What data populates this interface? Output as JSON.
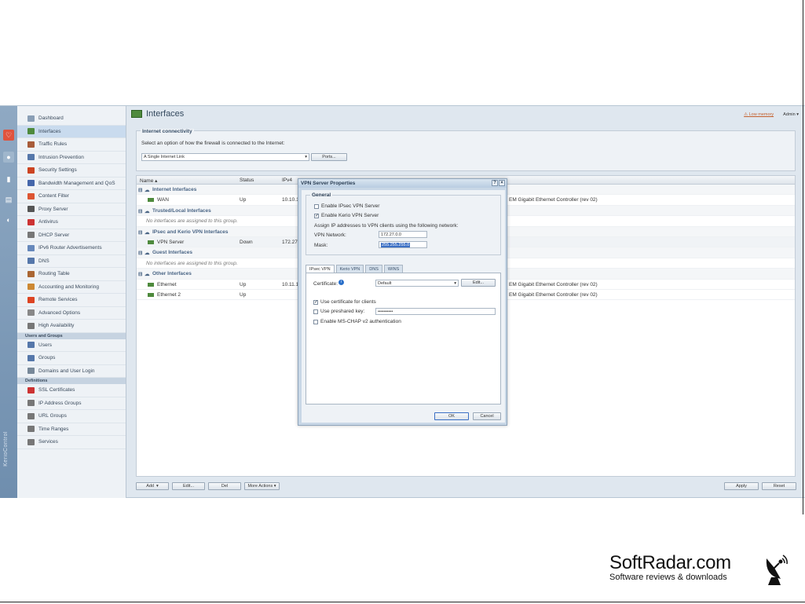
{
  "sidebar": {
    "items": [
      {
        "label": "Dashboard",
        "color": "#8a9fb6"
      },
      {
        "label": "Interfaces",
        "color": "#4e8a3d"
      },
      {
        "label": "Traffic Rules",
        "color": "#a85c3a"
      },
      {
        "label": "Intrusion Prevention",
        "color": "#5577aa"
      },
      {
        "label": "Security Settings",
        "color": "#cc4422"
      },
      {
        "label": "Bandwidth Management and QoS",
        "color": "#4466aa"
      },
      {
        "label": "Content Filter",
        "color": "#dd5533"
      },
      {
        "label": "Proxy Server",
        "color": "#555555"
      },
      {
        "label": "Antivirus",
        "color": "#cc3333"
      },
      {
        "label": "DHCP Server",
        "color": "#777777"
      },
      {
        "label": "IPv6 Router Advertisements",
        "color": "#6688bb"
      },
      {
        "label": "DNS",
        "color": "#5577aa"
      },
      {
        "label": "Routing Table",
        "color": "#aa6633"
      },
      {
        "label": "Accounting and Monitoring",
        "color": "#cc8833"
      },
      {
        "label": "Remote Services",
        "color": "#dd4422"
      },
      {
        "label": "Advanced Options",
        "color": "#888888"
      },
      {
        "label": "High Availability",
        "color": "#777777"
      }
    ],
    "section_users": "Users and Groups",
    "users_items": [
      {
        "label": "Users",
        "color": "#5577aa"
      },
      {
        "label": "Groups",
        "color": "#5577aa"
      },
      {
        "label": "Domains and User Login",
        "color": "#778899"
      }
    ],
    "section_defs": "Definitions",
    "defs_items": [
      {
        "label": "SSL Certificates",
        "color": "#cc3333"
      },
      {
        "label": "IP Address Groups",
        "color": "#777777"
      },
      {
        "label": "URL Groups",
        "color": "#777777"
      },
      {
        "label": "Time Ranges",
        "color": "#777777"
      },
      {
        "label": "Services",
        "color": "#777777"
      }
    ],
    "rail_text": "KerioControl"
  },
  "header": {
    "title": "Interfaces",
    "warning": "Low memory",
    "user": "Admin ▾"
  },
  "connectivity": {
    "legend": "Internet connectivity",
    "prompt": "Select an option of how the firewall is connected to the Internet:",
    "selected": "A Single Internet Link",
    "ports_btn": "Ports..."
  },
  "table": {
    "cols": [
      "Name ▴",
      "Status",
      "IPv4"
    ],
    "rows": [
      {
        "type": "g",
        "name": "Internet Interfaces"
      },
      {
        "type": "r",
        "name": "WAN",
        "status": "Up",
        "ip": "10.10.1",
        "desc": "EM Gigabit Ethernet Controller (rev 02)"
      },
      {
        "type": "g",
        "name": "Trusted/Local Interfaces"
      },
      {
        "type": "e",
        "name": "No interfaces are assigned to this group."
      },
      {
        "type": "g",
        "name": "IPsec and Kerio VPN Interfaces"
      },
      {
        "type": "h",
        "name": "VPN Server",
        "status": "Down",
        "ip": "172.27.",
        "desc": ""
      },
      {
        "type": "g",
        "name": "Guest Interfaces"
      },
      {
        "type": "e",
        "name": "No interfaces are assigned to this group."
      },
      {
        "type": "g",
        "name": "Other Interfaces"
      },
      {
        "type": "r",
        "name": "Ethernet",
        "status": "Up",
        "ip": "10.11.1",
        "desc": "EM Gigabit Ethernet Controller (rev 02)"
      },
      {
        "type": "r",
        "name": "Ethernet 2",
        "status": "Up",
        "ip": "",
        "desc": "EM Gigabit Ethernet Controller (rev 02)"
      }
    ]
  },
  "bottom": {
    "add": "Add",
    "edit": "Edit...",
    "del": "Del",
    "more": "More Actions ▾",
    "apply": "Apply",
    "reset": "Reset"
  },
  "dialog": {
    "title": "VPN Server Properties",
    "general": "General",
    "ipsec_enable": "Enable IPsec VPN Server",
    "kerio_enable": "Enable Kerio VPN Server",
    "assign_text": "Assign IP addresses to VPN clients using the following network:",
    "network_label": "VPN Network:",
    "network_value": "172.27.0.0",
    "mask_label": "Mask:",
    "mask_value": "255.255.255.0",
    "tabs": [
      "IPsec VPN",
      "Kerio VPN",
      "DNS",
      "WINS"
    ],
    "cert_label": "Certificate:",
    "cert_value": "Default",
    "edit_btn": "Edit...",
    "use_cert": "Use certificate for clients",
    "use_psk": "Use preshared key:",
    "psk_value": "••••••••••",
    "mschap": "Enable MS-CHAP v2 authentication",
    "ok": "OK",
    "cancel": "Cancel"
  },
  "watermark": {
    "brand": "SoftRadar.com",
    "tagline": "Software reviews & downloads"
  }
}
